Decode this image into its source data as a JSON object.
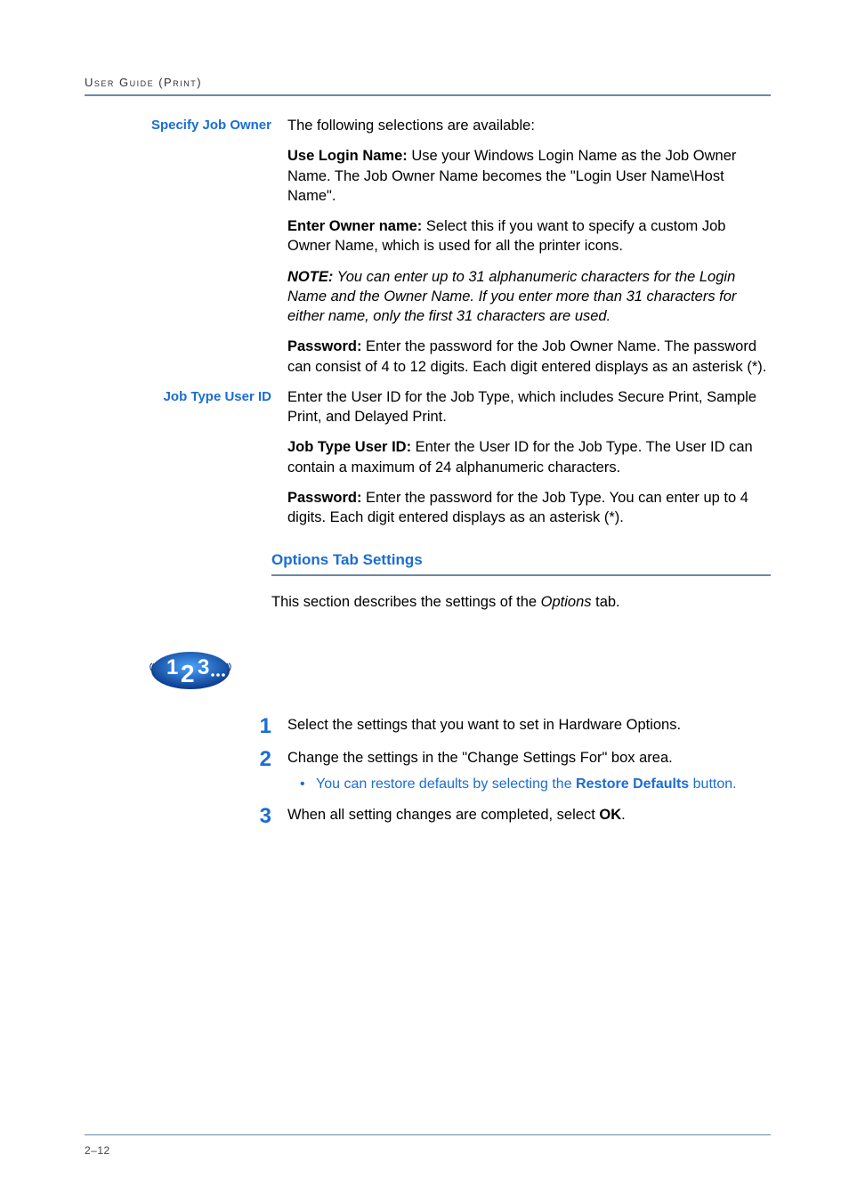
{
  "runningHead": "User Guide (Print)",
  "specifyJobOwner": {
    "label": "Specify Job Owner",
    "intro": "The following selections are available:",
    "useLoginName": {
      "bold": "Use Login Name:",
      "text": " Use your Windows Login Name as the Job Owner Name. The Job Owner Name becomes the \"Login User Name\\Host Name\"."
    },
    "enterOwnerName": {
      "bold": "Enter Owner name:",
      "text": " Select this if you want to specify a custom Job Owner Name, which is used for all the printer icons."
    },
    "note": {
      "bold": "NOTE:",
      "text": " You can enter up to 31 alphanumeric characters for the Login Name and the Owner Name. If you enter more than 31 characters for either name, only the first 31 characters are used."
    },
    "password": {
      "bold": "Password:",
      "text": " Enter the password for the Job Owner Name. The password can consist of 4 to 12 digits. Each digit entered displays as an asterisk (*)."
    }
  },
  "jobTypeUserId": {
    "label": "Job Type User ID",
    "intro": "Enter the User ID for the Job Type, which includes Secure Print, Sample Print, and Delayed Print.",
    "userId": {
      "bold": "Job Type User ID:",
      "text": " Enter the User ID for the Job Type. The User ID can contain a maximum of 24 alphanumeric characters."
    },
    "password": {
      "bold": "Password:",
      "text": " Enter the password for the Job Type. You can enter up to 4 digits. Each digit entered displays as an asterisk (*)."
    }
  },
  "optionsTab": {
    "heading": "Options Tab Settings",
    "intro_a": "This section describes the settings of the ",
    "intro_italic": "Options",
    "intro_b": " tab."
  },
  "steps": {
    "s1": {
      "num": "1",
      "text": "Select the settings that you want to set in Hardware Options."
    },
    "s2": {
      "num": "2",
      "text": "Change the settings in the \"Change Settings For\" box area.",
      "sub_a": "You can restore defaults by selecting the ",
      "sub_bold": "Restore Defaults",
      "sub_b": " button."
    },
    "s3": {
      "num": "3",
      "text_a": "When all setting changes are completed, select ",
      "text_bold": "OK",
      "text_b": "."
    }
  },
  "pageNum": "2–12"
}
